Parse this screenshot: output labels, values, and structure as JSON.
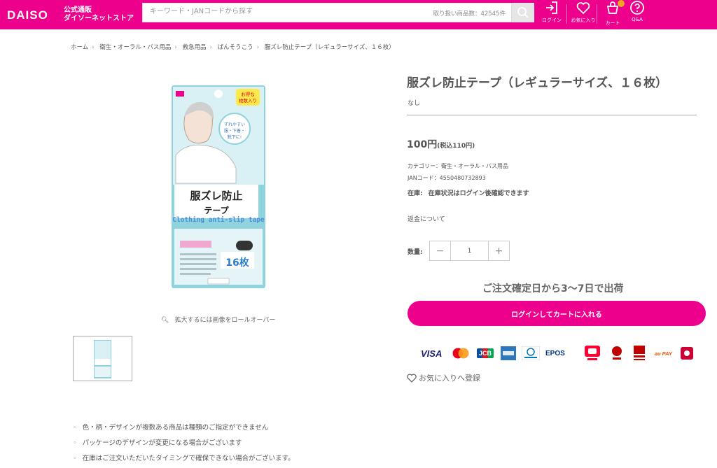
{
  "header": {
    "logo": "DAISO",
    "store_line1": "公式通販",
    "store_line2": "ダイソーネットストア",
    "search_placeholder": "キーワード・JANコードから探す",
    "item_count": "取り扱い商品数：42545件",
    "nav": {
      "login": "ログイン",
      "favorites": "お気に入り",
      "cart": "カート",
      "qa": "Q&A"
    }
  },
  "breadcrumb": [
    "ホーム",
    "衛生・オーラル・バス用品",
    "救急用品",
    "ばんそうこう",
    "服ズレ防止テープ（レギュラーサイズ、１６枚）"
  ],
  "product": {
    "title": "服ズレ防止テープ（レギュラーサイズ、１６枚）",
    "subtitle": "なし",
    "price_main": "100円",
    "price_tax": "(税込110円)",
    "category": "カテゴリー：衛生・オーラル・バス用品",
    "jan": "JANコード：4550480732893",
    "stock_label": "在庫:",
    "stock_value": "在庫状況はログイン後確認できます",
    "refund": "返金について",
    "qty_label": "数量:",
    "qty_minus": "−",
    "qty_value": "1",
    "qty_plus": "+",
    "shipping": "ご注文確定日から3〜7日で出荷",
    "cta": "ログインしてカートに入れる",
    "favorite": "お気に入りへ登録",
    "zoom_hint": "拡大するには画像をロールオーバー"
  },
  "package": {
    "badge": "お得な枚数入り",
    "name_line1": "服ズレ防止",
    "name_line2": "テープ",
    "english": "Clothing anti-slip tape",
    "count": "16枚"
  },
  "payments": {
    "visa": "VISA",
    "jcb": "JCB",
    "epos": "EPOS",
    "au_pay": "au PAY"
  },
  "notes": [
    "色・柄・デザインが複数ある商品は種類のご指定ができません",
    "パッケージのデザインが変更になる場合がございます",
    "在庫はご注文いただいたタイミングで確保できない場合がございます。"
  ],
  "colors": {
    "brand": "#ec008c",
    "cart_badge": "#f5a623"
  }
}
